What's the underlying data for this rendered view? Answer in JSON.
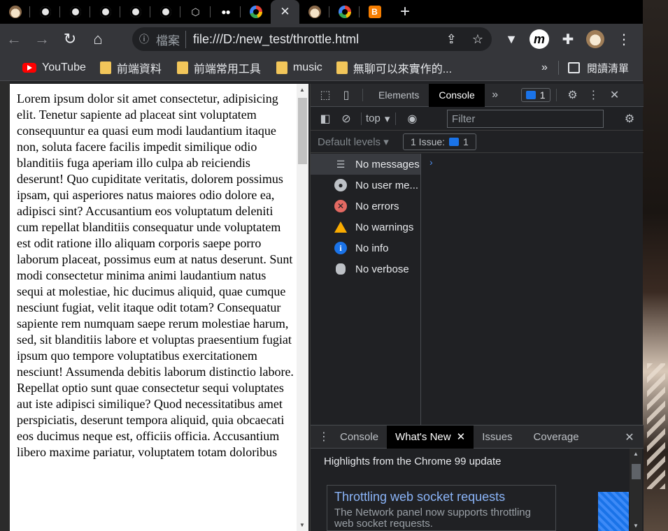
{
  "tabs": [
    {
      "icon": "hedgehog-favicon"
    },
    {
      "icon": "github-favicon"
    },
    {
      "icon": "github-favicon"
    },
    {
      "icon": "github-favicon"
    },
    {
      "icon": "github-favicon"
    },
    {
      "icon": "github-favicon"
    },
    {
      "icon": "codesandbox-favicon"
    },
    {
      "icon": "medium-favicon"
    },
    {
      "icon": "google-favicon"
    },
    {
      "icon": "close-icon",
      "active": true
    },
    {
      "icon": "hedgehog-favicon"
    },
    {
      "icon": "google-favicon"
    },
    {
      "icon": "blogger-favicon"
    }
  ],
  "address": {
    "label": "檔案",
    "url": "file:///D:/new_test/throttle.html"
  },
  "bookmarks": [
    {
      "label": "YouTube",
      "icon": "youtube-icon"
    },
    {
      "label": "前端資料",
      "icon": "folder-icon"
    },
    {
      "label": "前端常用工具",
      "icon": "folder-icon"
    },
    {
      "label": "music",
      "icon": "folder-icon"
    },
    {
      "label": "無聊可以來實作的...",
      "icon": "folder-icon"
    }
  ],
  "bookmarks_more": "»",
  "reading_list": "閱讀清單",
  "page": {
    "text": "Lorem ipsum dolor sit amet consectetur, adipisicing elit. Tenetur sapiente ad placeat sint voluptatem consequuntur ea quasi eum modi laudantium itaque non, soluta facere facilis impedit similique odio blanditiis fuga aperiam illo culpa ab reiciendis deserunt! Quo cupiditate veritatis, dolorem possimus ipsam, qui asperiores natus maiores odio dolore ea, adipisci sint? Accusantium eos voluptatum deleniti cum repellat blanditiis consequatur unde voluptatem est odit ratione illo aliquam corporis saepe porro laborum placeat, possimus eum at natus deserunt. Sunt modi consectetur minima animi laudantium natus sequi at molestiae, hic ducimus aliquid, quae cumque nesciunt fugiat, velit itaque odit totam? Consequatur sapiente rem numquam saepe rerum molestiae harum, sed, sit blanditiis labore et voluptas praesentium fugiat ipsum quo tempore voluptatibus exercitationem nesciunt! Assumenda debitis laborum distinctio labore. Repellat optio sunt quae consectetur sequi voluptates aut iste adipisci similique? Quod necessitatibus amet perspiciatis, deserunt tempora aliquid, quia obcaecati eos ducimus neque est, officiis officia. Accusantium libero maxime pariatur, voluptatem totam doloribus"
  },
  "devtools": {
    "tabs": [
      "Elements",
      "Console"
    ],
    "active_tab": "Console",
    "more": "»",
    "issue_count": "1",
    "context": "top",
    "filter_placeholder": "Filter",
    "levels": "Default levels",
    "issues_label": "1 Issue:",
    "issues_count": "1",
    "sidebar": [
      {
        "label": "No messages",
        "icon": "list-icon",
        "selected": true
      },
      {
        "label": "No user me...",
        "icon": "user-icon"
      },
      {
        "label": "No errors",
        "icon": "error-icon"
      },
      {
        "label": "No warnings",
        "icon": "warning-icon"
      },
      {
        "label": "No info",
        "icon": "info-icon"
      },
      {
        "label": "No verbose",
        "icon": "bug-icon"
      }
    ],
    "prompt": "›",
    "drawer_tabs": [
      "Console",
      "What's New",
      "Issues",
      "Coverage"
    ],
    "drawer_active": "What's New",
    "highlights": "Highlights from the Chrome 99 update",
    "whats_new_title": "Throttling web socket requests",
    "whats_new_desc": "The Network panel now supports throttling web socket requests."
  },
  "colors": {
    "accent": "#1a73e8",
    "link": "#8ab4f8",
    "devtools_bg": "#202124"
  }
}
